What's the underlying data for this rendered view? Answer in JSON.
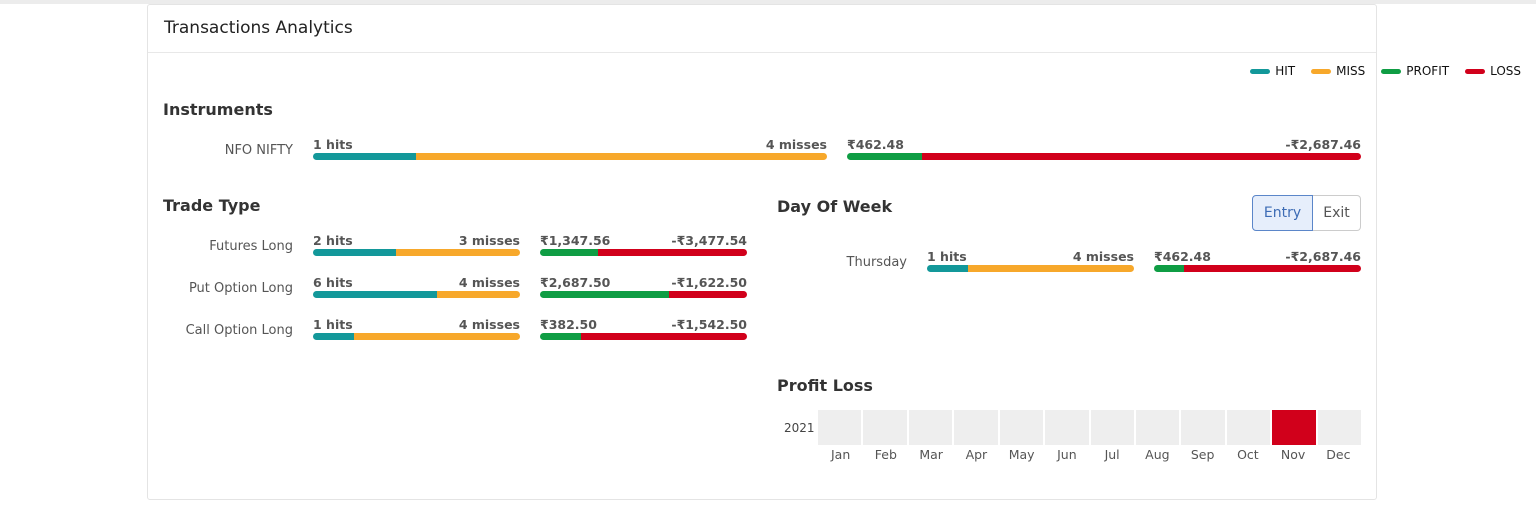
{
  "title": "Transactions Analytics",
  "colors": {
    "hit": "#13989a",
    "miss": "#f7a82b",
    "profit": "#0f9d44",
    "loss": "#d1001b",
    "empty_cell": "#eeeeee"
  },
  "legend": [
    {
      "label": "HIT",
      "color": "#13989a"
    },
    {
      "label": "MISS",
      "color": "#f7a82b"
    },
    {
      "label": "PROFIT",
      "color": "#0f9d44"
    },
    {
      "label": "LOSS",
      "color": "#d1001b"
    }
  ],
  "instruments": {
    "title": "Instruments",
    "rows": [
      {
        "label": "NFO NIFTY",
        "hits": "1 hits",
        "misses": "4 misses",
        "hits_count": 1,
        "misses_count": 4,
        "profit": "₹462.48",
        "loss": "-₹2,687.46",
        "profit_value": 462.48,
        "loss_value": 2687.46
      }
    ]
  },
  "trade_type": {
    "title": "Trade Type",
    "rows": [
      {
        "label": "Futures Long",
        "hits": "2 hits",
        "misses": "3 misses",
        "hits_count": 2,
        "misses_count": 3,
        "profit": "₹1,347.56",
        "loss": "-₹3,477.54",
        "profit_value": 1347.56,
        "loss_value": 3477.54
      },
      {
        "label": "Put Option Long",
        "hits": "6 hits",
        "misses": "4 misses",
        "hits_count": 6,
        "misses_count": 4,
        "profit": "₹2,687.50",
        "loss": "-₹1,622.50",
        "profit_value": 2687.5,
        "loss_value": 1622.5
      },
      {
        "label": "Call Option Long",
        "hits": "1 hits",
        "misses": "4 misses",
        "hits_count": 1,
        "misses_count": 4,
        "profit": "₹382.50",
        "loss": "-₹1,542.50",
        "profit_value": 382.5,
        "loss_value": 1542.5
      }
    ]
  },
  "day_of_week": {
    "title": "Day Of Week",
    "toggle": {
      "entry": "Entry",
      "exit": "Exit",
      "selected": "Entry"
    },
    "rows": [
      {
        "label": "Thursday",
        "hits": "1 hits",
        "misses": "4 misses",
        "hits_count": 1,
        "misses_count": 4,
        "profit": "₹462.48",
        "loss": "-₹2,687.46",
        "profit_value": 462.48,
        "loss_value": 2687.46
      }
    ]
  },
  "profit_loss": {
    "title": "Profit Loss",
    "year": "2021",
    "months": [
      "Jan",
      "Feb",
      "Mar",
      "Apr",
      "May",
      "Jun",
      "Jul",
      "Aug",
      "Sep",
      "Oct",
      "Nov",
      "Dec"
    ],
    "highlighted_month": "Nov",
    "highlight_color": "#d1001b"
  }
}
